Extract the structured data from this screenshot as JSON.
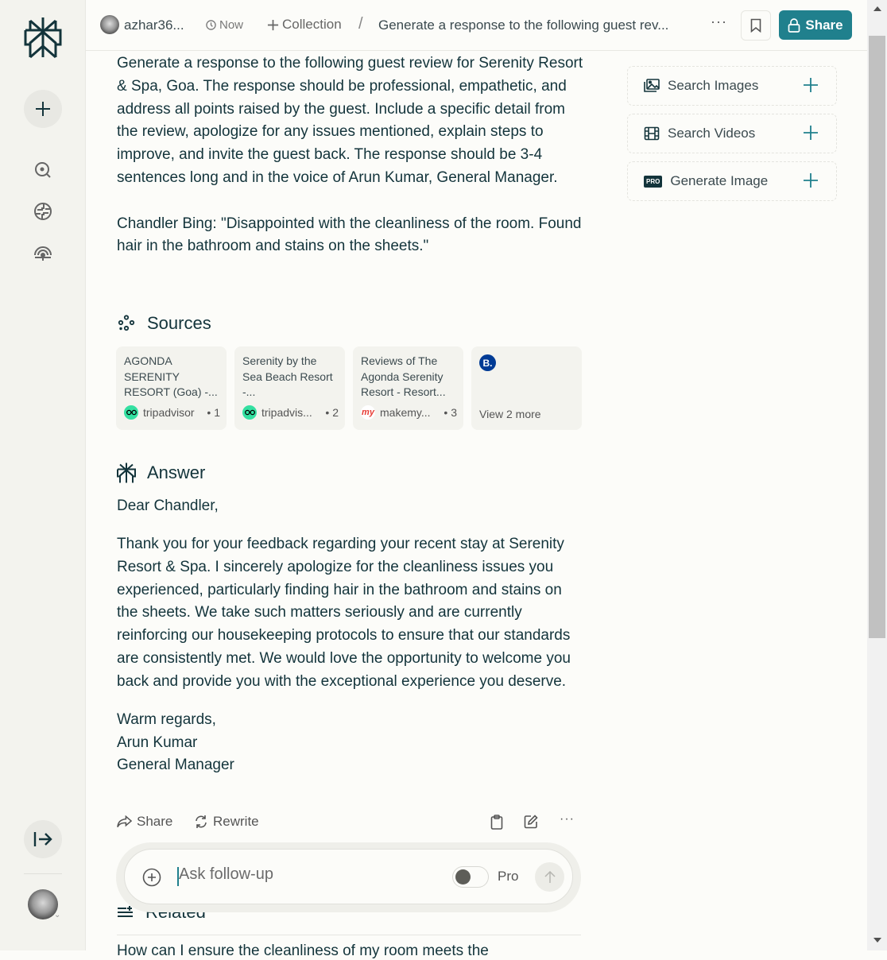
{
  "topbar": {
    "username": "azhar36...",
    "time": "Now",
    "collection_label": "Collection",
    "separator": "/",
    "thread_title": "Generate a response to the following guest rev...",
    "more_label": "···",
    "share_label": "Share",
    "accent_color": "#20808d"
  },
  "sidebar": {
    "items": [
      {
        "name": "new-thread",
        "icon": "plus-icon"
      },
      {
        "name": "discover",
        "icon": "search-icon"
      },
      {
        "name": "spaces",
        "icon": "globe-icon"
      },
      {
        "name": "library",
        "icon": "signal-icon"
      }
    ],
    "collapse_icon": "expand-arrow-icon"
  },
  "query": {
    "paragraphs": [
      "Generate a response to the following guest review for Serenity Resort & Spa, Goa. The response should be professional, empathetic, and address all points raised by the guest. Include a specific detail from the review, apologize for any issues mentioned, explain steps to improve, and invite the guest back. The response should be 3-4 sentences long and in the voice of Arun Kumar, General Manager.",
      "Chandler Bing: \"Disappointed with the cleanliness of the room. Found hair in the bathroom and stains on the sheets.\""
    ]
  },
  "sources": {
    "heading": "Sources",
    "items": [
      {
        "title": "AGONDA SERENITY RESORT (Goa) -...",
        "site": "tripadvisor",
        "index": "• 1",
        "favicon": "tripadvisor-icon"
      },
      {
        "title": "Serenity by the Sea Beach Resort -...",
        "site": "tripadvis...",
        "index": "• 2",
        "favicon": "tripadvisor-icon"
      },
      {
        "title": "Reviews of The Agonda Serenity Resort - Resort...",
        "site": "makemy...",
        "index": "• 3",
        "favicon": "makemytrip-icon"
      }
    ],
    "more": {
      "favicon_text": "B.",
      "label": "View 2 more"
    }
  },
  "answer": {
    "heading": "Answer",
    "greeting": "Dear Chandler,",
    "body": "Thank you for your feedback regarding your recent stay at Serenity Resort & Spa. I sincerely apologize for the cleanliness issues you experienced, particularly finding hair in the bathroom and stains on the sheets. We take such matters seriously and are currently reinforcing our housekeeping protocols to ensure that our standards are consistently met. We would love the opportunity to welcome you back and provide you with the exceptional experience you deserve.",
    "signoff": [
      "Warm regards,",
      "Arun Kumar",
      "General Manager"
    ]
  },
  "answer_actions": {
    "share_label": "Share",
    "rewrite_label": "Rewrite"
  },
  "followup": {
    "placeholder": "Ask follow-up",
    "value": "",
    "pro_label": "Pro",
    "pro_enabled": false
  },
  "related": {
    "heading": "Related",
    "first_item_partial": "How can I ensure the cleanliness of my room meets the"
  },
  "right_panel": {
    "items": [
      {
        "label": "Search Images",
        "icon": "image-icon"
      },
      {
        "label": "Search Videos",
        "icon": "film-icon"
      },
      {
        "label": "Generate Image",
        "icon": "pro-badge-icon",
        "badge": "PRO"
      }
    ]
  }
}
